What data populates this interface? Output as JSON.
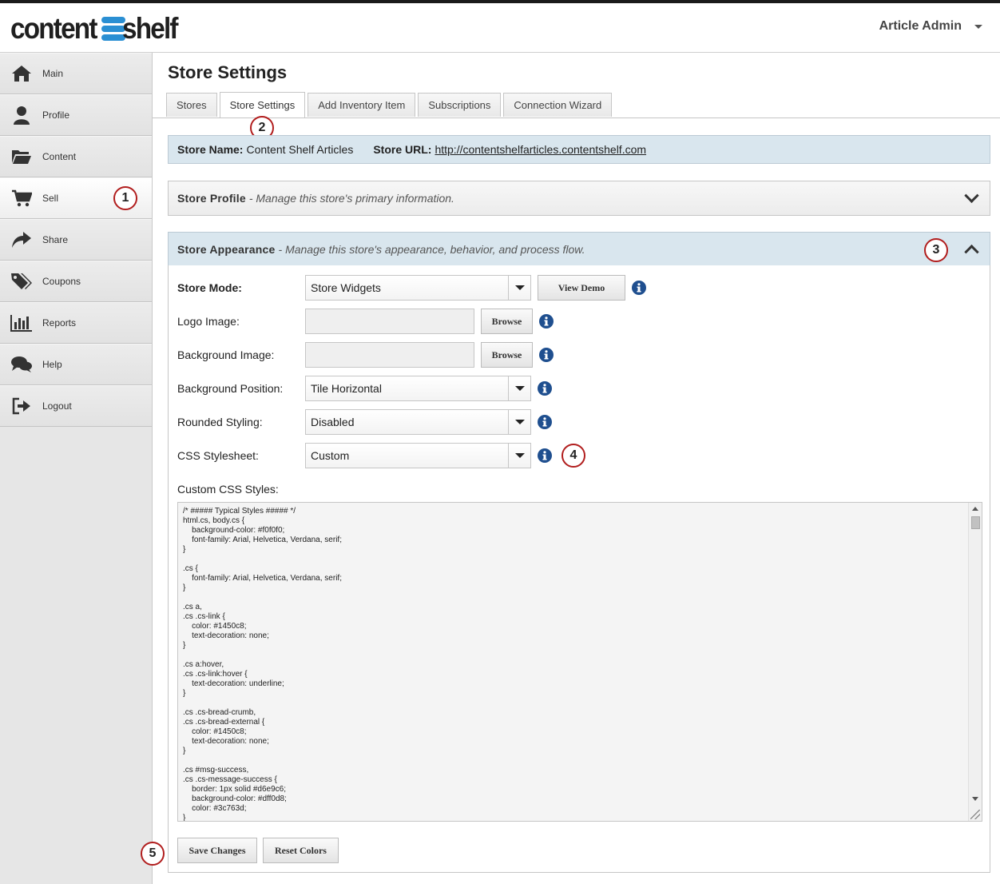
{
  "app": {
    "logo_part1": "content",
    "logo_part2": "shelf",
    "user_menu_label": "Article Admin"
  },
  "sidebar": {
    "items": [
      {
        "label": "Main",
        "icon": "home-icon"
      },
      {
        "label": "Profile",
        "icon": "user-icon"
      },
      {
        "label": "Content",
        "icon": "folder-icon"
      },
      {
        "label": "Sell",
        "icon": "cart-icon"
      },
      {
        "label": "Share",
        "icon": "share-icon"
      },
      {
        "label": "Coupons",
        "icon": "tag-icon"
      },
      {
        "label": "Reports",
        "icon": "bar-chart-icon"
      },
      {
        "label": "Help",
        "icon": "chat-icon"
      },
      {
        "label": "Logout",
        "icon": "logout-icon"
      }
    ]
  },
  "callouts": [
    "1",
    "2",
    "3",
    "4",
    "5"
  ],
  "page": {
    "title": "Store Settings",
    "tabs": [
      "Stores",
      "Store Settings",
      "Add Inventory Item",
      "Subscriptions",
      "Connection Wizard"
    ],
    "active_tab": "Store Settings"
  },
  "store_info": {
    "name_label": "Store Name:",
    "name_value": "Content Shelf Articles",
    "url_label": "Store URL:",
    "url_value": "http://contentshelfarticles.contentshelf.com"
  },
  "store_profile": {
    "title": "Store Profile",
    "description": "- Manage this store's primary information."
  },
  "store_appearance": {
    "title": "Store Appearance",
    "description": "- Manage this store's appearance, behavior, and process flow.",
    "store_mode_label": "Store Mode:",
    "store_mode_value": "Store Widgets",
    "view_demo_label": "View Demo",
    "logo_image_label": "Logo Image:",
    "background_image_label": "Background Image:",
    "browse_label": "Browse",
    "background_position_label": "Background Position:",
    "background_position_value": "Tile Horizontal",
    "rounded_styling_label": "Rounded Styling:",
    "rounded_styling_value": "Disabled",
    "css_stylesheet_label": "CSS Stylesheet:",
    "css_stylesheet_value": "Custom",
    "custom_css_label": "Custom CSS Styles:",
    "custom_css_text": "/* ##### Typical Styles ##### */\nhtml.cs, body.cs {\n    background-color: #f0f0f0;\n    font-family: Arial, Helvetica, Verdana, serif;\n}\n\n.cs {\n    font-family: Arial, Helvetica, Verdana, serif;\n}\n\n.cs a,\n.cs .cs-link {\n    color: #1450c8;\n    text-decoration: none;\n}\n\n.cs a:hover,\n.cs .cs-link:hover {\n    text-decoration: underline;\n}\n\n.cs .cs-bread-crumb,\n.cs .cs-bread-external {\n    color: #1450c8;\n    text-decoration: none;\n}\n\n.cs #msg-success,\n.cs .cs-message-success {\n    border: 1px solid #d6e9c6;\n    background-color: #dff0d8;\n    color: #3c763d;\n}",
    "save_label": "Save Changes",
    "reset_label": "Reset Colors"
  },
  "colors": {
    "accent_blue": "#2a8fd3",
    "info_icon_blue": "#1f4f8f",
    "callout_red": "#b11d1d",
    "store_bar_bg": "#d9e6ee"
  }
}
